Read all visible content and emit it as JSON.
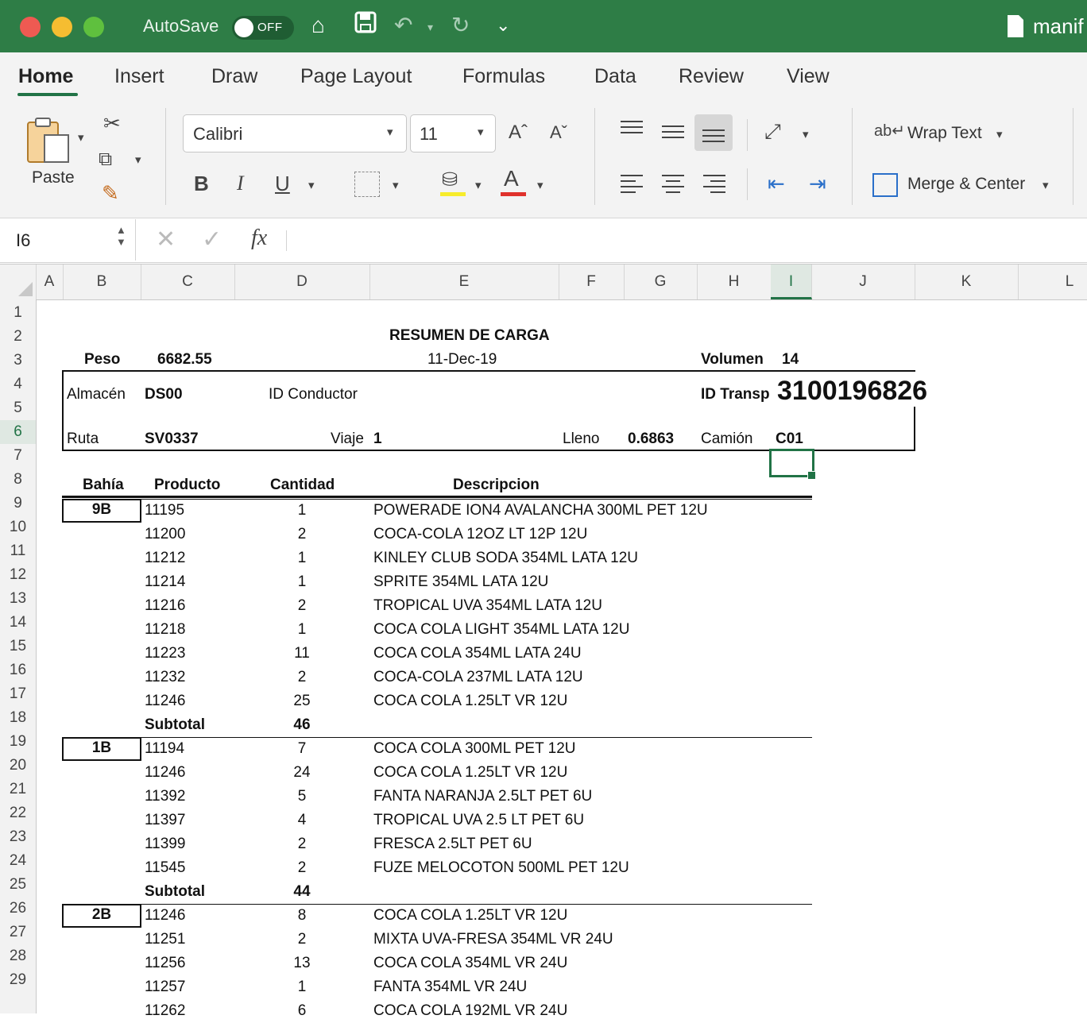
{
  "titlebar": {
    "autosave_label": "AutoSave",
    "toggle_state": "OFF",
    "filename": "manif"
  },
  "tabs": [
    "Home",
    "Insert",
    "Draw",
    "Page Layout",
    "Formulas",
    "Data",
    "Review",
    "View"
  ],
  "ribbon": {
    "paste_label": "Paste",
    "font_name": "Calibri",
    "font_size": "11",
    "wrap_text": "Wrap Text",
    "merge_center": "Merge & Center",
    "bold": "B",
    "italic": "I",
    "underline": "U"
  },
  "formula_bar": {
    "name_box": "I6",
    "fx": "fx",
    "content": ""
  },
  "columns": [
    "A",
    "B",
    "C",
    "D",
    "E",
    "F",
    "G",
    "H",
    "I",
    "J",
    "K",
    "L"
  ],
  "selected_cell": "I6",
  "sheet": {
    "title": "RESUMEN DE CARGA",
    "peso_label": "Peso",
    "peso_value": "6682.55",
    "date": "11-Dec-19",
    "volumen_label": "Volumen",
    "volumen_value": "14",
    "almacen_label": "Almacén",
    "almacen_value": "DS00",
    "conductor_label": "ID Conductor",
    "transp_label": "ID Transp",
    "transp_value": "3100196826",
    "ruta_label": "Ruta",
    "ruta_value": "SV0337",
    "viaje_label": "Viaje",
    "viaje_value": "1",
    "lleno_label": "Lleno",
    "lleno_value": "0.6863",
    "camion_label": "Camión",
    "camion_value": "C01",
    "headers": {
      "bahia": "Bahía",
      "producto": "Producto",
      "cantidad": "Cantidad",
      "descripcion": "Descripcion"
    },
    "rows": [
      {
        "bay": "9B",
        "prod": "11195",
        "qty": "1",
        "desc": "POWERADE ION4 AVALANCHA 300ML PET 12U"
      },
      {
        "bay": "",
        "prod": "11200",
        "qty": "2",
        "desc": "COCA-COLA 12OZ LT 12P 12U"
      },
      {
        "bay": "",
        "prod": "11212",
        "qty": "1",
        "desc": "KINLEY CLUB SODA 354ML LATA 12U"
      },
      {
        "bay": "",
        "prod": "11214",
        "qty": "1",
        "desc": "SPRITE 354ML LATA 12U"
      },
      {
        "bay": "",
        "prod": "11216",
        "qty": "2",
        "desc": "TROPICAL UVA 354ML LATA 12U"
      },
      {
        "bay": "",
        "prod": "11218",
        "qty": "1",
        "desc": "COCA COLA LIGHT 354ML LATA 12U"
      },
      {
        "bay": "",
        "prod": "11223",
        "qty": "11",
        "desc": "COCA COLA 354ML LATA 24U"
      },
      {
        "bay": "",
        "prod": "11232",
        "qty": "2",
        "desc": "COCA-COLA 237ML LATA 12U"
      },
      {
        "bay": "",
        "prod": "11246",
        "qty": "25",
        "desc": "COCA COLA 1.25LT VR 12U"
      },
      {
        "bay": "",
        "prod": "Subtotal",
        "qty": "46",
        "desc": "",
        "subtotal": true
      },
      {
        "bay": "1B",
        "prod": "11194",
        "qty": "7",
        "desc": "COCA COLA 300ML PET 12U"
      },
      {
        "bay": "",
        "prod": "11246",
        "qty": "24",
        "desc": "COCA COLA 1.25LT VR 12U"
      },
      {
        "bay": "",
        "prod": "11392",
        "qty": "5",
        "desc": "FANTA NARANJA 2.5LT PET 6U"
      },
      {
        "bay": "",
        "prod": "11397",
        "qty": "4",
        "desc": "TROPICAL UVA 2.5 LT PET 6U"
      },
      {
        "bay": "",
        "prod": "11399",
        "qty": "2",
        "desc": "FRESCA 2.5LT PET 6U"
      },
      {
        "bay": "",
        "prod": "11545",
        "qty": "2",
        "desc": "FUZE MELOCOTON 500ML PET 12U"
      },
      {
        "bay": "",
        "prod": "Subtotal",
        "qty": "44",
        "desc": "",
        "subtotal": true
      },
      {
        "bay": "2B",
        "prod": "11246",
        "qty": "8",
        "desc": "COCA COLA 1.25LT VR 12U"
      },
      {
        "bay": "",
        "prod": "11251",
        "qty": "2",
        "desc": "MIXTA UVA-FRESA 354ML VR 24U"
      },
      {
        "bay": "",
        "prod": "11256",
        "qty": "13",
        "desc": "COCA COLA 354ML VR 24U"
      },
      {
        "bay": "",
        "prod": "11257",
        "qty": "1",
        "desc": "FANTA 354ML VR 24U"
      },
      {
        "bay": "",
        "prod": "11262",
        "qty": "6",
        "desc": "COCA COLA 192ML VR 24U"
      }
    ]
  },
  "colors": {
    "excel_green": "#217346",
    "titlebar": "#2e7d46"
  }
}
